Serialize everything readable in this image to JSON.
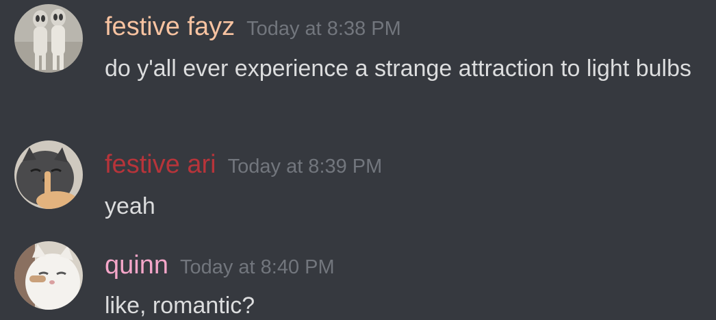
{
  "messages": [
    {
      "username": "festive fayz",
      "username_color": "#f8c3a1",
      "timestamp": "Today at 8:38 PM",
      "text": "do y'all ever experience a strange attraction to light bulbs",
      "avatar_icon": "two-alien-figures-avatar"
    },
    {
      "username": "festive ari",
      "username_color": "#b7343a",
      "timestamp": "Today at 8:39 PM",
      "text": "yeah",
      "avatar_icon": "grey-cat-with-finger-avatar"
    },
    {
      "username": "quinn",
      "username_color": "#f5a6c9",
      "timestamp": "Today at 8:40 PM",
      "text": "like, romantic?",
      "avatar_icon": "white-cat-avatar"
    }
  ]
}
